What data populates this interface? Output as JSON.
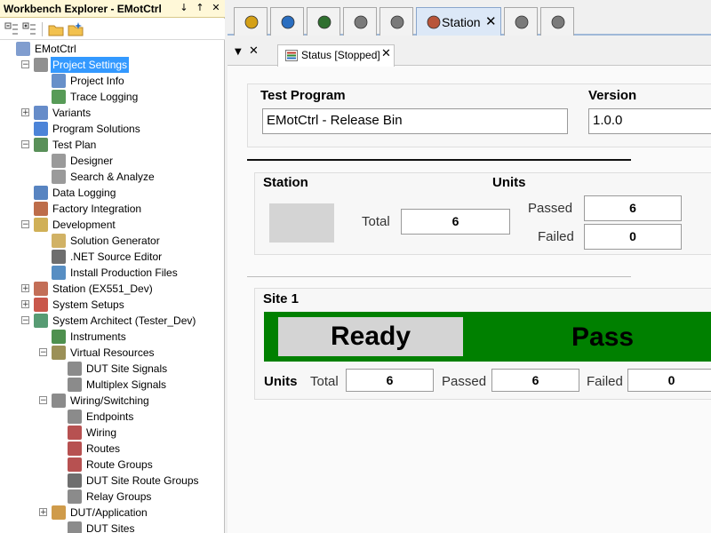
{
  "explorer": {
    "title": "Workbench Explorer - EMotCtrl",
    "pin_glyph": "↓",
    "dock_glyph": "↑",
    "close_glyph": "✕",
    "tree": [
      {
        "label": "EMotCtrl",
        "level": 0,
        "exp": "",
        "icon": "project-icon",
        "color": "#6a8cc7"
      },
      {
        "label": "Project Settings",
        "level": 1,
        "exp": "−",
        "icon": "tools-icon",
        "color": "#7d7d7d",
        "selected": true
      },
      {
        "label": "Project Info",
        "level": 2,
        "exp": "",
        "icon": "info-doc-icon",
        "color": "#4c7dbf"
      },
      {
        "label": "Trace Logging",
        "level": 2,
        "exp": "",
        "icon": "log-icon",
        "color": "#3a8a3a"
      },
      {
        "label": "Variants",
        "level": 1,
        "exp": "+",
        "icon": "variants-icon",
        "color": "#4b78c0"
      },
      {
        "label": "Program Solutions",
        "level": 1,
        "exp": "",
        "icon": "star-icon",
        "color": "#2d6fd1"
      },
      {
        "label": "Test Plan",
        "level": 1,
        "exp": "−",
        "icon": "test-plan-icon",
        "color": "#3c7d3c"
      },
      {
        "label": "Designer",
        "level": 2,
        "exp": "",
        "icon": "designer-icon",
        "color": "#888"
      },
      {
        "label": "Search & Analyze",
        "level": 2,
        "exp": "",
        "icon": "search-analyze-icon",
        "color": "#888"
      },
      {
        "label": "Data Logging",
        "level": 1,
        "exp": "",
        "icon": "data-logging-icon",
        "color": "#3b6fb6"
      },
      {
        "label": "Factory Integration",
        "level": 1,
        "exp": "",
        "icon": "factory-icon",
        "color": "#b2532a"
      },
      {
        "label": "Development",
        "level": 1,
        "exp": "−",
        "icon": "development-icon",
        "color": "#c8a23a"
      },
      {
        "label": "Solution Generator",
        "level": 2,
        "exp": "",
        "icon": "generator-icon",
        "color": "#c9a54a"
      },
      {
        "label": ".NET Source Editor",
        "level": 2,
        "exp": "",
        "icon": "ide-icon",
        "color": "#555"
      },
      {
        "label": "Install Production Files",
        "level": 2,
        "exp": "",
        "icon": "install-icon",
        "color": "#3a7ab8"
      },
      {
        "label": "Station (EX551_Dev)",
        "level": 1,
        "exp": "+",
        "icon": "station-icon",
        "color": "#b8553a"
      },
      {
        "label": "System Setups",
        "level": 1,
        "exp": "+",
        "icon": "system-setups-icon",
        "color": "#c0392b"
      },
      {
        "label": "System Architect (Tester_Dev)",
        "level": 1,
        "exp": "−",
        "icon": "architect-icon",
        "color": "#3a8a5a"
      },
      {
        "label": "Instruments",
        "level": 2,
        "exp": "",
        "icon": "instruments-icon",
        "color": "#2f7d2f"
      },
      {
        "label": "Virtual Resources",
        "level": 2,
        "exp": "−",
        "icon": "virtual-resources-icon",
        "color": "#8a7d3a"
      },
      {
        "label": "DUT Site Signals",
        "level": 3,
        "exp": "",
        "icon": "signals-icon",
        "color": "#777"
      },
      {
        "label": "Multiplex Signals",
        "level": 3,
        "exp": "",
        "icon": "multiplex-icon",
        "color": "#777"
      },
      {
        "label": "Wiring/Switching",
        "level": 2,
        "exp": "−",
        "icon": "wiring-switching-icon",
        "color": "#777"
      },
      {
        "label": "Endpoints",
        "level": 3,
        "exp": "",
        "icon": "endpoints-icon",
        "color": "#777"
      },
      {
        "label": "Wiring",
        "level": 3,
        "exp": "",
        "icon": "wiring-icon",
        "color": "#a33"
      },
      {
        "label": "Routes",
        "level": 3,
        "exp": "",
        "icon": "routes-icon",
        "color": "#a33"
      },
      {
        "label": "Route Groups",
        "level": 3,
        "exp": "",
        "icon": "route-groups-icon",
        "color": "#a33"
      },
      {
        "label": "DUT Site Route Groups",
        "level": 3,
        "exp": "",
        "icon": "site-route-groups-icon",
        "color": "#555"
      },
      {
        "label": "Relay Groups",
        "level": 3,
        "exp": "",
        "icon": "relay-groups-icon",
        "color": "#777"
      },
      {
        "label": "DUT/Application",
        "level": 2,
        "exp": "+",
        "icon": "dut-application-icon",
        "color": "#c78a2a"
      },
      {
        "label": "DUT Sites",
        "level": 3,
        "exp": "",
        "icon": "dut-sites-icon",
        "color": "#777"
      }
    ]
  },
  "tabs": [
    {
      "name": "tab-home",
      "icon": "home-icon",
      "color": "#d4a017"
    },
    {
      "name": "tab-globe",
      "icon": "globe-icon",
      "color": "#2a6ec0"
    },
    {
      "name": "tab-devices",
      "icon": "devices-icon",
      "color": "#2f6f2f"
    },
    {
      "name": "tab-editor",
      "icon": "editor-icon",
      "color": "#7a7a7a"
    },
    {
      "name": "tab-chart",
      "icon": "chart-icon",
      "color": "#7a7a7a"
    },
    {
      "name": "tab-station",
      "icon": "station-icon",
      "color": "#b8553a",
      "label": "Station",
      "active": true
    },
    {
      "name": "tab-matrix",
      "icon": "matrix-icon",
      "color": "#7a7a7a"
    },
    {
      "name": "tab-tools",
      "icon": "tools-icon",
      "color": "#7a7a7a"
    }
  ],
  "doc": {
    "menu_glyph": "▼",
    "close_glyph": "✕",
    "status_tab": {
      "label": "Status [Stopped]",
      "close": "✕"
    }
  },
  "test_program": {
    "label": "Test Program",
    "value": "EMotCtrl - Release Bin"
  },
  "version": {
    "label": "Version",
    "value": "1.0.0"
  },
  "station": {
    "label": "Station",
    "total_label": "Total",
    "total": "6"
  },
  "units": {
    "label": "Units",
    "passed_label": "Passed",
    "passed": "6",
    "failed_label": "Failed",
    "failed": "0"
  },
  "site1": {
    "label": "Site 1",
    "state": "Ready",
    "result": "Pass",
    "result_color": "#008000",
    "units_label": "Units",
    "total_label": "Total",
    "total": "6",
    "passed_label": "Passed",
    "passed": "6",
    "failed_label": "Failed",
    "failed": "0"
  }
}
